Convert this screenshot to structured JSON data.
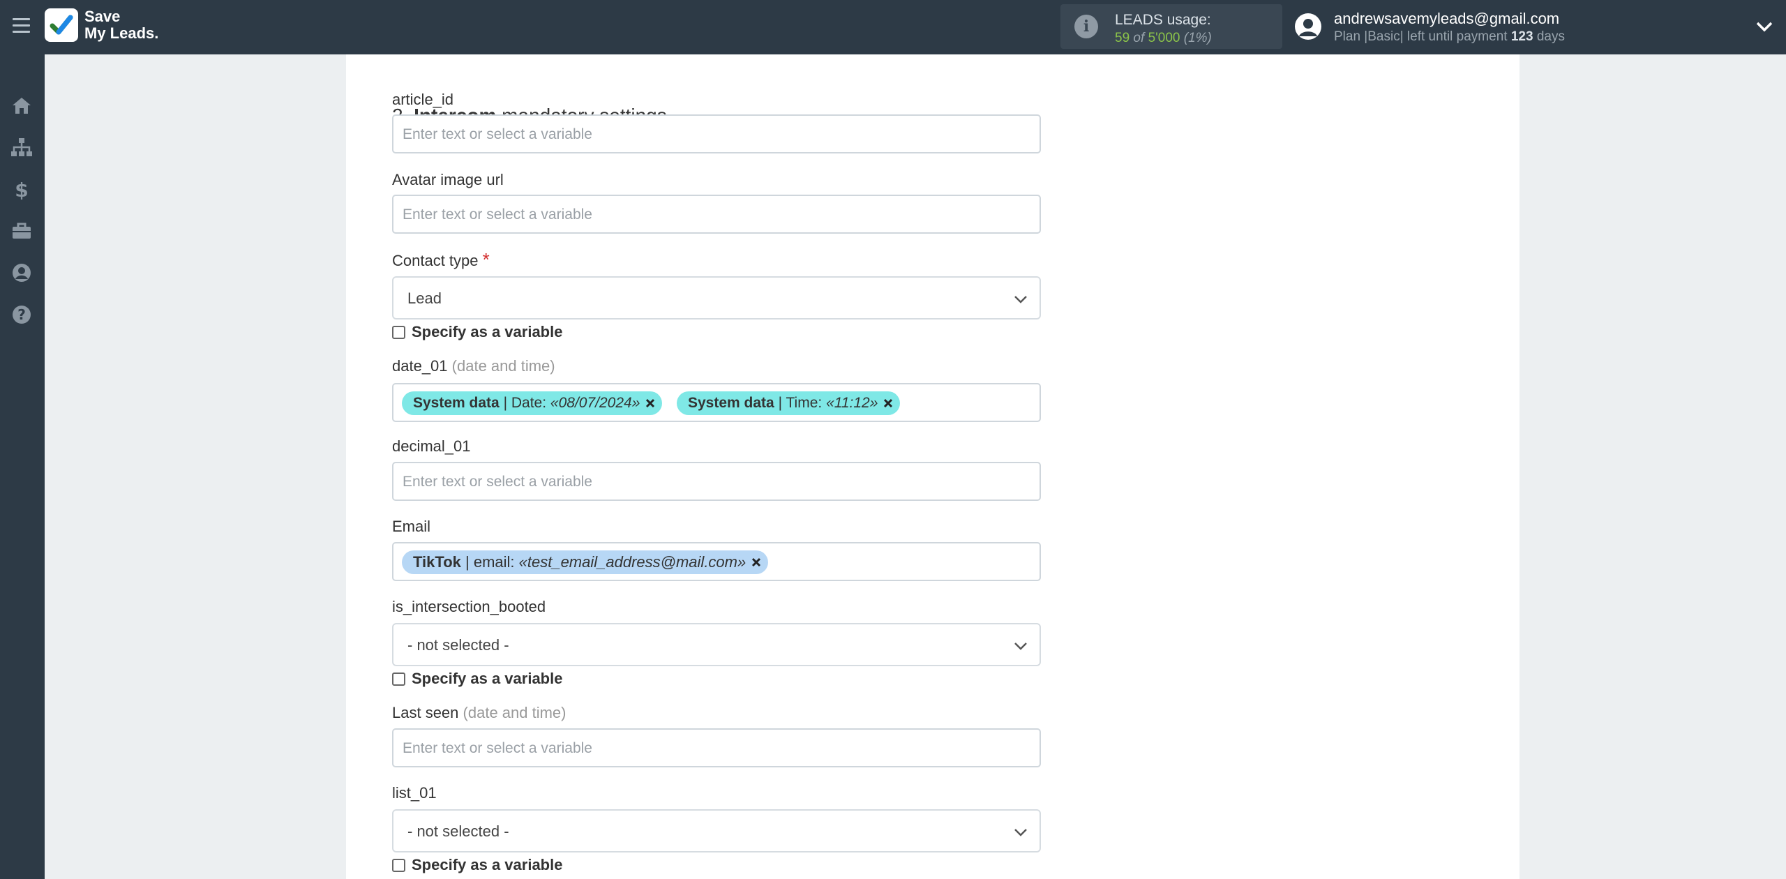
{
  "header": {
    "logo_line1": "Save",
    "logo_line2": "My Leads.",
    "leads_title": "LEADS usage:",
    "leads_used": "59",
    "leads_of": "of",
    "leads_total": "5'000",
    "leads_percent": "(1%)",
    "user_email": "andrewsavemyleads@gmail.com",
    "plan_prefix": "Plan |Basic| left until payment",
    "plan_days": "123",
    "plan_suffix": "days"
  },
  "sidebar": {
    "icons": [
      "home-icon",
      "sitemap-icon",
      "dollar-icon",
      "briefcase-icon",
      "user-circle-icon",
      "question-circle-icon"
    ]
  },
  "form": {
    "section_number": "2.",
    "section_app": "Intercom",
    "section_rest": "mandatory settings",
    "placeholder": "Enter text or select a variable",
    "specify_label": "Specify as a variable",
    "fields": {
      "article_id": {
        "label": "article_id"
      },
      "avatar": {
        "label": "Avatar image url"
      },
      "contact_type": {
        "label": "Contact type",
        "required": "*",
        "value": "Lead"
      },
      "date_01": {
        "label": "date_01",
        "hint": "(date and time)",
        "tags": [
          {
            "source": "System data",
            "field": "| Date:",
            "value": "«08/07/2024»"
          },
          {
            "source": "System data",
            "field": "| Time:",
            "value": "«11:12»"
          }
        ]
      },
      "decimal_01": {
        "label": "decimal_01"
      },
      "email": {
        "label": "Email",
        "tags": [
          {
            "source": "TikTok",
            "field": "| email:",
            "value": "«test_email_address@mail.com»"
          }
        ]
      },
      "is_intersection_booted": {
        "label": "is_intersection_booted",
        "value": "- not selected -"
      },
      "last_seen": {
        "label": "Last seen",
        "hint": "(date and time)"
      },
      "list_01": {
        "label": "list_01",
        "value": "- not selected -"
      }
    }
  },
  "colors": {
    "topbar": "#2d3a46",
    "tag_system": "#7fe8e6",
    "tag_tiktok": "#b7d7f5",
    "leads_used": "#8bc34a",
    "required": "#d32f2f"
  }
}
